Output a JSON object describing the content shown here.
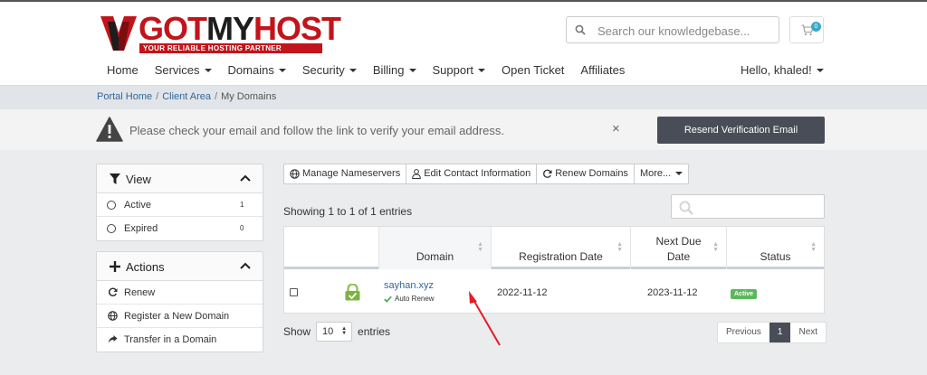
{
  "header": {
    "logo": {
      "part1": "GOT",
      "part2": "MY",
      "part3": "HOST",
      "tagline": "YOUR RELIABLE HOSTING PARTNER"
    },
    "search": {
      "placeholder": "Search our knowledgebase..."
    },
    "cart_count": "0",
    "nav": [
      {
        "label": "Home",
        "dropdown": false
      },
      {
        "label": "Services",
        "dropdown": true
      },
      {
        "label": "Domains",
        "dropdown": true
      },
      {
        "label": "Security",
        "dropdown": true
      },
      {
        "label": "Billing",
        "dropdown": true
      },
      {
        "label": "Support",
        "dropdown": true
      },
      {
        "label": "Open Ticket",
        "dropdown": false
      },
      {
        "label": "Affiliates",
        "dropdown": false
      }
    ],
    "user_greeting": "Hello, khaled!"
  },
  "breadcrumb": {
    "items": [
      "Portal Home",
      "Client Area",
      "My Domains"
    ]
  },
  "alert": {
    "message": "Please check your email and follow the link to verify your email address.",
    "close": "×",
    "button": "Resend Verification Email"
  },
  "sidebar": {
    "view": {
      "title": "View",
      "items": [
        {
          "label": "Active",
          "count": "1"
        },
        {
          "label": "Expired",
          "count": "0"
        }
      ]
    },
    "actions": {
      "title": "Actions",
      "items": [
        {
          "label": "Renew",
          "icon": "refresh-icon"
        },
        {
          "label": "Register a New Domain",
          "icon": "globe-icon"
        },
        {
          "label": "Transfer in a Domain",
          "icon": "share-icon"
        }
      ]
    }
  },
  "toolbar": {
    "manage_ns": "Manage Nameservers",
    "edit_contact": "Edit Contact Information",
    "renew": "Renew Domains",
    "more": "More..."
  },
  "table": {
    "info": "Showing 1 to 1 of 1 entries",
    "headers": {
      "domain": "Domain",
      "reg_date": "Registration Date",
      "next_due_1": "Next Due",
      "next_due_2": "Date",
      "status": "Status"
    },
    "rows": [
      {
        "domain": "sayhan.xyz",
        "auto_renew": "Auto Renew",
        "reg_date": "2022-11-12",
        "next_due": "2023-11-12",
        "status": "Active"
      }
    ]
  },
  "length": {
    "prefix": "Show",
    "value": "10",
    "suffix": "entries"
  },
  "pagination": {
    "previous": "Previous",
    "current": "1",
    "next": "Next"
  },
  "colors": {
    "brand_red": "#c1151b",
    "dark_button": "#484d57",
    "active_green": "#5cb85c",
    "link": "#336699"
  }
}
